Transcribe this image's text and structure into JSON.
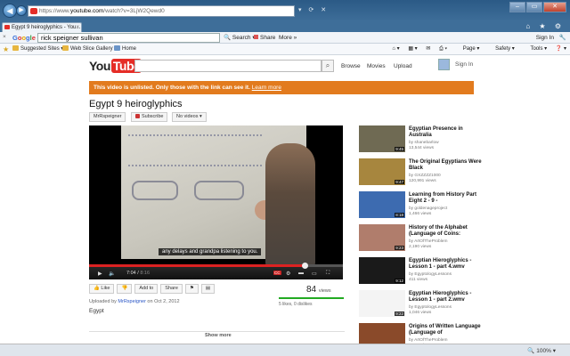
{
  "browser": {
    "url_prefix": "https://www.",
    "url_domain": "youtube.com",
    "url_path": "/watch?v=3LjW2Qewd0",
    "tab_title": "Egypt 9 heiroglyphics - You...",
    "google_query": "rick speigner sullivan",
    "google_buttons": [
      "Search",
      "Share",
      "More »"
    ],
    "google_signin": "Sign In",
    "favorites": [
      "Suggested Sites",
      "Web Slice Gallery",
      "Home"
    ],
    "commands": [
      "Page",
      "Safety",
      "Tools"
    ],
    "zoom": "100%"
  },
  "youtube": {
    "logo_you": "You",
    "logo_tube": "Tube",
    "nav": [
      "Browse",
      "Movies",
      "Upload"
    ],
    "signin": "Sign In"
  },
  "notice": {
    "text": "This video is unlisted. Only those with the link can see it.",
    "link": "Learn more"
  },
  "video": {
    "title": "Egypt 9 heiroglyphics",
    "channel": "MrRspeigner",
    "subscribe": "Subscribe",
    "no_videos": "No videos",
    "caption": "any delays and grandpa listening to you.",
    "time_current": "7:04",
    "time_total": "8:16",
    "cc": "CC",
    "progress": 0.85,
    "buttons": [
      "Like",
      "Add to",
      "Share"
    ],
    "views": "84",
    "views_label": "views",
    "likes": "5 likes, 0 dislikes",
    "uploaded_prefix": "Uploaded by ",
    "uploader": "MrRspeigner",
    "uploaded_date": " on Oct 2, 2012",
    "category": "Egypt",
    "show_more": "Show more"
  },
  "related": [
    {
      "title": "Egyptian Presence in Australia",
      "by": "by shanebarlow",
      "views": "13,544 views",
      "duration": "9:45",
      "color": "#6f6a53"
    },
    {
      "title": "The Original Egyptians Were Black",
      "by": "by GXZZZZ1000",
      "views": "120,991 views",
      "duration": "9:47",
      "color": "#a7863e"
    },
    {
      "title": "Learning from History Part Eight 2 - 9 -",
      "by": "by goldenageproject",
      "views": "1,466 views",
      "duration": "8:18",
      "color": "#3d6bb0"
    },
    {
      "title": "History of the Alphabet (Language of Coins:",
      "by": "by ArtOfTheProblem",
      "views": "2,190 views",
      "duration": "9:23",
      "color": "#b07d6c"
    },
    {
      "title": "Egyptian Hieroglyphics - Lesson 1 - part 4.wmv",
      "by": "by EgyptologyLessons",
      "views": "411 views",
      "duration": "9:12",
      "color": "#1a1a1a"
    },
    {
      "title": "Egyptian Hieroglyphics - Lesson 1 - part 2.wmv",
      "by": "by EgyptologyLessons",
      "views": "1,046 views",
      "duration": "9:22",
      "color": "#f4f4f4"
    },
    {
      "title": "Origins of Written Language (Language of",
      "by": "by ArtOfTheProblem",
      "views": "4,295 views",
      "duration": "8:16",
      "color": "#8a4a2a"
    }
  ]
}
